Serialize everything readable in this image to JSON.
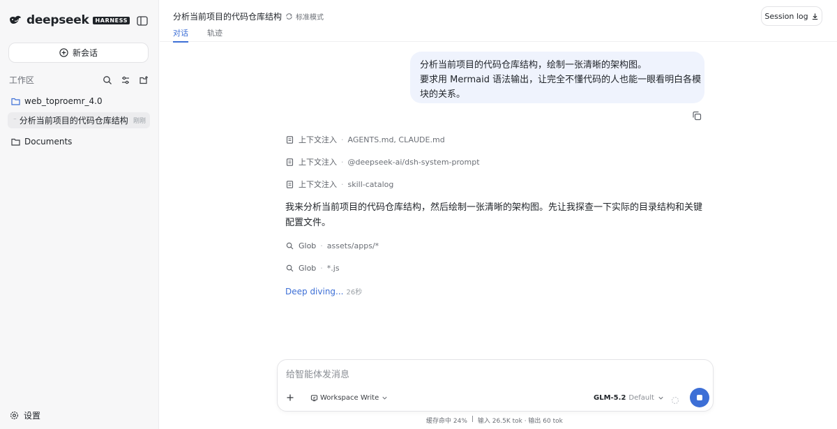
{
  "brand": {
    "wordmark": "deepseek",
    "badge": "HARNESS"
  },
  "sidebar": {
    "new_chat_label": "新会话",
    "workspace_label": "工作区",
    "items": [
      {
        "label": "web_toproemr_4.0",
        "icon": "folder-icon"
      },
      {
        "label": "分析当前项目的代码仓库结构",
        "time": "刚刚",
        "active": true
      },
      {
        "label": "Documents",
        "icon": "folder-icon"
      }
    ],
    "settings_label": "设置"
  },
  "header": {
    "title": "分析当前项目的代码仓库结构",
    "mode": "标准模式",
    "tabs": [
      {
        "label": "对话",
        "active": true
      },
      {
        "label": "轨迹"
      }
    ],
    "session_log_label": "Session log"
  },
  "conversation": {
    "user_message": [
      "分析当前项目的代码仓库结构，绘制一张清晰的架构图。",
      "要求用 Mermaid 语法输出，让完全不懂代码的人也能一眼看明白各模",
      "块的关系。"
    ],
    "context_steps": [
      {
        "label": "上下文注入",
        "detail": "AGENTS.md, CLAUDE.md"
      },
      {
        "label": "上下文注入",
        "detail": "@deepseek-ai/dsh-system-prompt"
      },
      {
        "label": "上下文注入",
        "detail": "skill-catalog"
      }
    ],
    "assistant_message": [
      "我来分析当前项目的代码仓库结构，然后绘制一张清晰的架构图。先让我探查一下实际的目录结构和关键",
      "配置文件。"
    ],
    "tool_steps": [
      {
        "label": "Glob",
        "detail": "assets/apps/*"
      },
      {
        "label": "Glob",
        "detail": "*.js"
      }
    ],
    "thinking_label": "Deep diving...",
    "thinking_time": "26秒"
  },
  "composer": {
    "placeholder": "给智能体发消息",
    "value": "",
    "permission_label": "Workspace Write",
    "model_name": "GLM-5.2",
    "model_variant": "Default"
  },
  "status": {
    "cache": "缓存命中 24%",
    "divider": "|",
    "tokens": "输入 26.5K tok · 输出 60 tok"
  },
  "colors": {
    "accent": "#3d6fd6",
    "user_bubble": "#eff3fd",
    "sidebar_bg": "#f7f7f8"
  }
}
